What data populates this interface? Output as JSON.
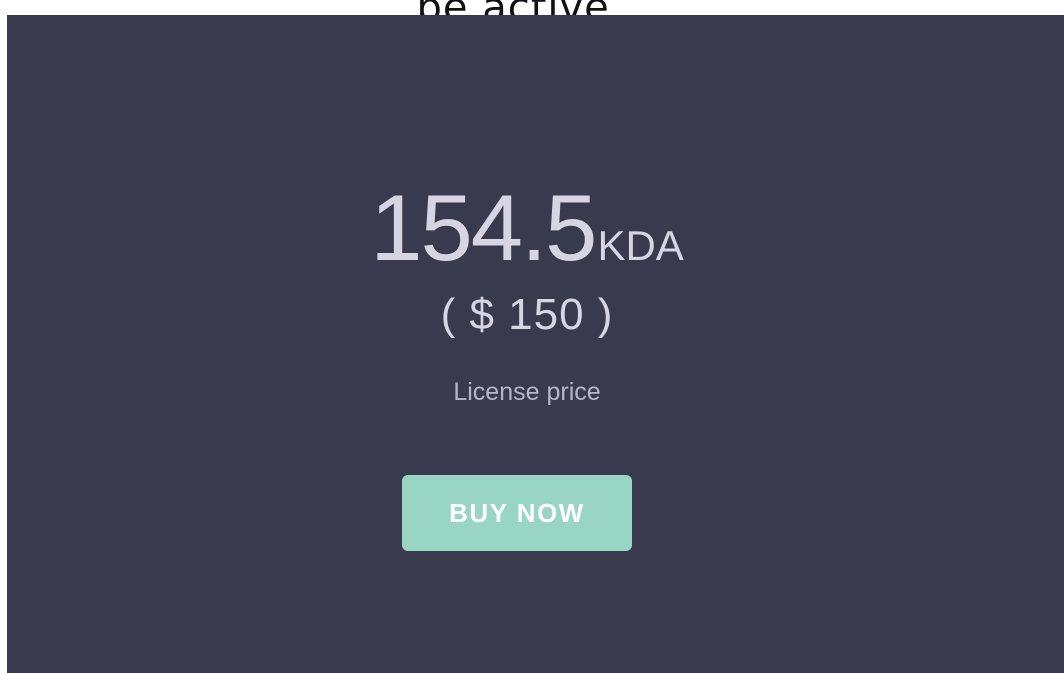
{
  "header": {
    "caption": "be active."
  },
  "pricing": {
    "amount": "154.5",
    "unit": "KDA",
    "usd_equivalent": "( $ 150 )",
    "caption": "License price",
    "buy_label": "BUY NOW"
  },
  "colors": {
    "card_background": "#3a3a4f",
    "price_text": "#d7d4e3",
    "caption_text": "#b8b6c6",
    "button_background": "#98d5c3",
    "button_text": "#ffffff"
  }
}
